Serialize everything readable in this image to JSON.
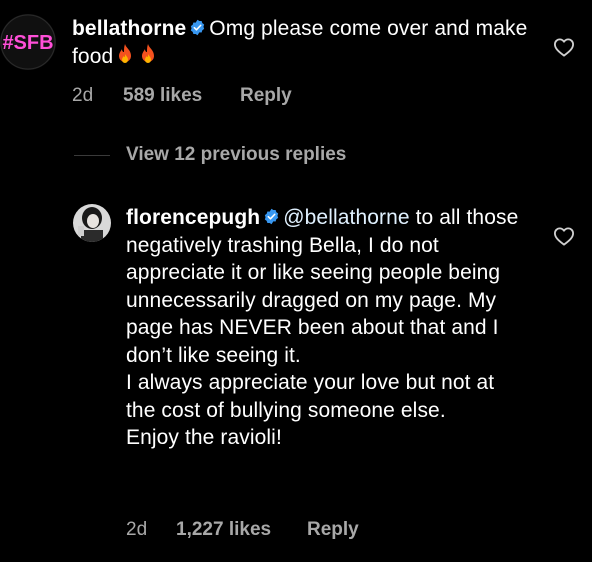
{
  "comments": [
    {
      "username": "bellathorne",
      "verified": true,
      "avatar_label": "#SFB",
      "text": "Omg please come over and make food",
      "emojis": [
        "fire-emoji",
        "fire-emoji"
      ],
      "time": "2d",
      "likes": "589 likes",
      "reply_label": "Reply"
    },
    {
      "username": "florencepugh",
      "verified": true,
      "mention": "@bellathorne",
      "paragraphs": [
        " to all those negatively trashing Bella, I do not appreciate it or like seeing people being unnecessarily dragged on my page. My page has NEVER been about that and I don’t like seeing it.",
        "I always appreciate your love but not at the cost of bullying someone else.",
        "Enjoy the ravioli!"
      ],
      "time": "2d",
      "likes": "1,227 likes",
      "reply_label": "Reply"
    }
  ],
  "view_replies": "View 12 previous replies",
  "colors": {
    "background": "#000000",
    "text": "#ffffff",
    "secondary": "#a8a8a8",
    "verified": "#3897f0",
    "avatar_label": "#ff4fd8"
  }
}
